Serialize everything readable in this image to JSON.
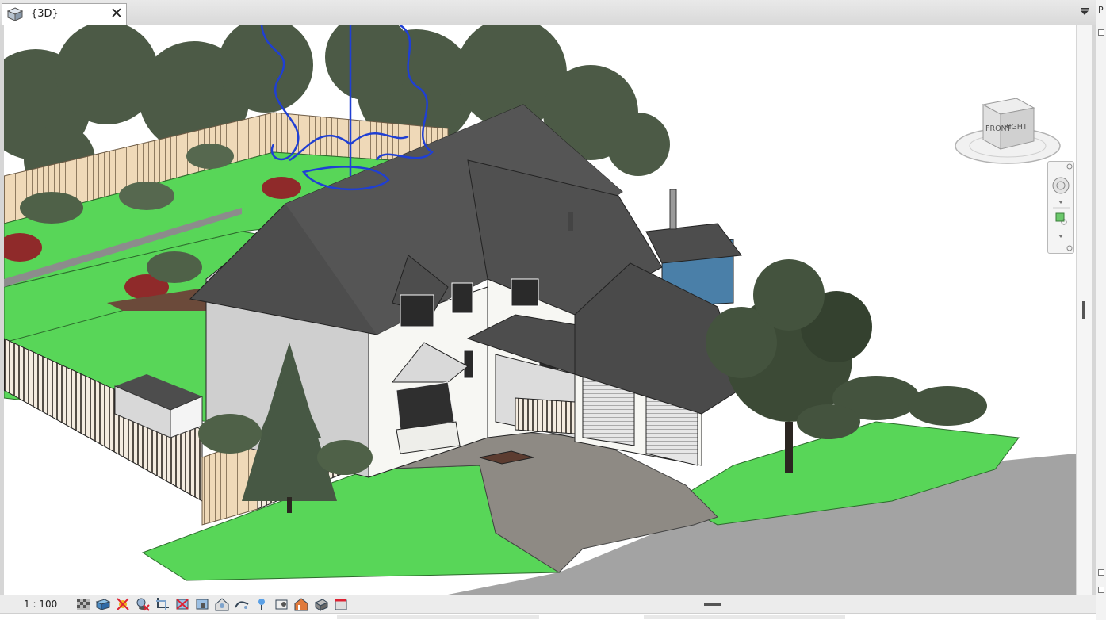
{
  "tab": {
    "icon": "3d-view-icon",
    "label": "{3D}",
    "close_label": "✕"
  },
  "viewcube": {
    "front_label": "FRONT",
    "right_label": "RIGHT"
  },
  "statusbar": {
    "scale": "1 : 100",
    "tools": [
      "detail-level-icon",
      "visual-style-icon",
      "sun-path-icon",
      "shadows-icon",
      "crop-view-icon",
      "show-crop-region-icon",
      "unlock-3d-view-icon",
      "temporary-hide-isolate-icon",
      "reveal-hidden-elements-icon",
      "reveal-constraints-icon",
      "analytical-model-icon",
      "highlight-displacement-icon",
      "show-rendering-dialog-icon",
      "worksharing-display-icon"
    ]
  },
  "right_panel": {
    "letter": "P"
  },
  "colors": {
    "grass": "#58d658",
    "roof": "#4d4d4d",
    "wall": "#f7f7f3",
    "paving": "#8e8a84",
    "road": "#a3a3a3",
    "tree": "#3c4a36",
    "selection": "#1f3fd4"
  }
}
